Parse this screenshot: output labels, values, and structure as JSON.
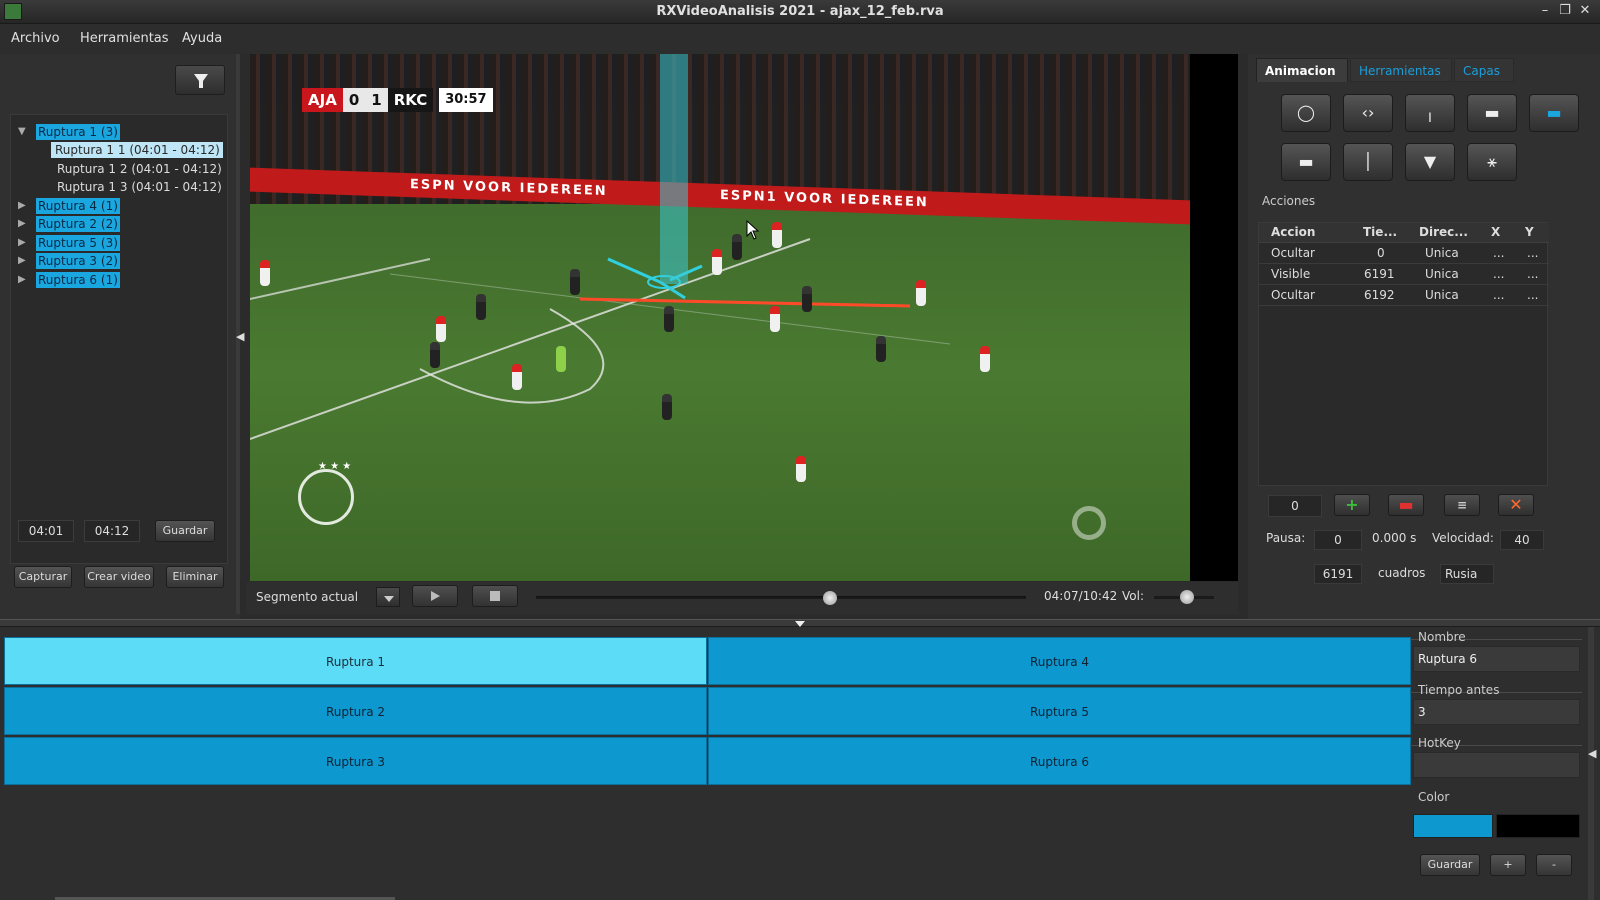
{
  "window": {
    "title": "RXVideoAnalisis 2021 - ajax_12_feb.rva"
  },
  "menu": [
    "Archivo",
    "Herramientas",
    "Ayuda"
  ],
  "tree": {
    "nodes": [
      {
        "label": "Ruptura 1 (3)",
        "expanded": true,
        "children": [
          "Ruptura 1 1 (04:01 - 04:12)",
          "Ruptura 1 2 (04:01 - 04:12)",
          "Ruptura 1 3 (04:01 - 04:12)"
        ]
      },
      {
        "label": "Ruptura 4 (1)"
      },
      {
        "label": "Ruptura 2 (2)"
      },
      {
        "label": "Ruptura 5 (3)"
      },
      {
        "label": "Ruptura 3 (2)"
      },
      {
        "label": "Ruptura 6 (1)"
      }
    ]
  },
  "left_controls": {
    "start_time": "04:01",
    "end_time": "04:12",
    "guardar": "Guardar",
    "capturar": "Capturar",
    "crear_video": "Crear video",
    "eliminar": "Eliminar"
  },
  "video": {
    "team_a": "AJA",
    "score_a": "0",
    "score_b": "1",
    "team_b": "RKC",
    "clock": "30:57",
    "board_text": "ESPN VOOR IEDEREEN"
  },
  "playback": {
    "segment": "Segmento actual",
    "time": "04:07/10:42",
    "vol_label": "Vol:",
    "progress": 0.6,
    "volume": 0.55
  },
  "right_tabs": [
    "Animacion",
    "Herramientas",
    "Capas"
  ],
  "acciones": {
    "label": "Acciones",
    "headers": [
      "Accion",
      "Tie...",
      "Direc...",
      "X",
      "Y"
    ],
    "rows": [
      [
        "Ocultar",
        "0",
        "Unica",
        "...",
        "..."
      ],
      [
        "Visible",
        "6191",
        "Unica",
        "...",
        "..."
      ],
      [
        "Ocultar",
        "6192",
        "Unica",
        "...",
        "..."
      ]
    ],
    "counter": "0"
  },
  "pause": {
    "pausa_label": "Pausa:",
    "pausa_value": "0",
    "seconds": "0.000 s",
    "velocidad_label": "Velocidad:",
    "velocidad_value": "40",
    "frames_value": "6191",
    "cuadros_label": "cuadros",
    "lang": "Rusia"
  },
  "segments": [
    [
      "Ruptura 1",
      "Ruptura 4"
    ],
    [
      "Ruptura 2",
      "Ruptura 5"
    ],
    [
      "Ruptura 3",
      "Ruptura 6"
    ]
  ],
  "props": {
    "nombre_label": "Nombre",
    "nombre_value": "Ruptura 6",
    "tiempo_label": "Tiempo antes",
    "tiempo_value": "3",
    "hotkey_label": "HotKey",
    "hotkey_value": "",
    "color_label": "Color",
    "color_primary": "#0d98d0",
    "color_secondary": "#000000",
    "guardar": "Guardar",
    "plus": "+",
    "minus": "-"
  }
}
